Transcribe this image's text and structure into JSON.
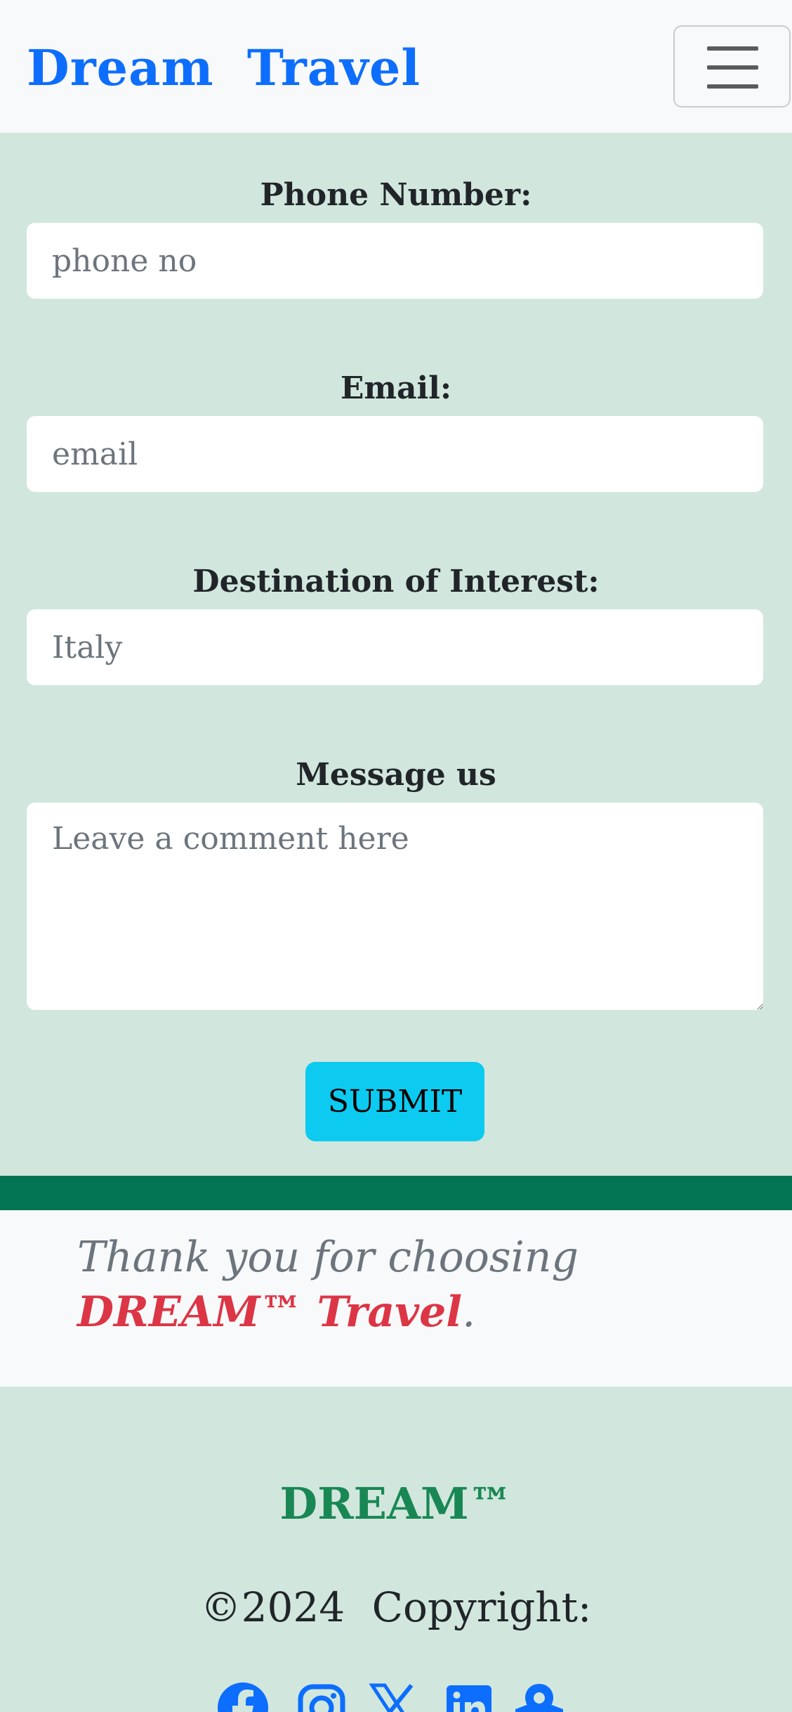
{
  "navbar": {
    "brand": "Dream  Travel",
    "menu_icon": "hamburger-menu-icon"
  },
  "form": {
    "phone_label": "Phone Number:",
    "phone_placeholder": "phone no",
    "email_label": "Email:",
    "email_placeholder": "email",
    "destination_label": "Destination of Interest:",
    "destination_placeholder": "Italy",
    "message_label": "Message us",
    "message_placeholder": "Leave a comment here",
    "submit_label": "SUBMIT"
  },
  "thanks": {
    "prefix": "Thank you for choosing ",
    "brand": "DREAM™ Travel",
    "suffix": "."
  },
  "footer": {
    "brand": "DREAM™",
    "copyright": "©2024  Copyright:",
    "social_icons": [
      "facebook-icon",
      "instagram-icon",
      "x-icon",
      "linkedin-icon",
      "map-pin-icon"
    ]
  },
  "colors": {
    "accent": "#0d6efd",
    "page_background": "#d1e7dd",
    "divider": "#027353",
    "submit": "#0dcaf0",
    "brand_red": "#dc3545",
    "footer_brand": "#198754"
  }
}
